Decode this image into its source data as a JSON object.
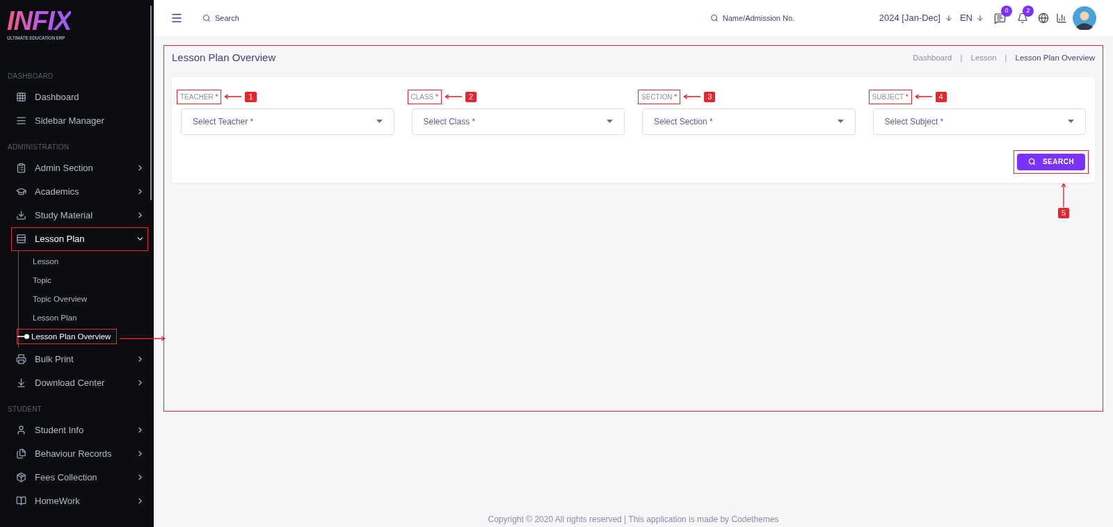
{
  "logo": {
    "name": "INFIX",
    "tagline": "ULTIMATE EDUCATION ERP"
  },
  "sidebar": {
    "sections": [
      {
        "title": "DASHBOARD",
        "items": [
          {
            "label": "Dashboard",
            "has_arrow": false,
            "expanded": false,
            "annotated": false
          },
          {
            "label": "Sidebar Manager",
            "has_arrow": false,
            "expanded": false,
            "annotated": false
          }
        ]
      },
      {
        "title": "ADMINISTRATION",
        "items": [
          {
            "label": "Admin Section",
            "has_arrow": true,
            "expanded": false,
            "annotated": false
          },
          {
            "label": "Academics",
            "has_arrow": true,
            "expanded": false,
            "annotated": false
          },
          {
            "label": "Study Material",
            "has_arrow": true,
            "expanded": false,
            "annotated": false
          },
          {
            "label": "Lesson Plan",
            "has_arrow": true,
            "expanded": true,
            "annotated": true,
            "children": [
              {
                "label": "Lesson",
                "selected": false,
                "annotated": false
              },
              {
                "label": "Topic",
                "selected": false,
                "annotated": false
              },
              {
                "label": "Topic Overview",
                "selected": false,
                "annotated": false
              },
              {
                "label": "Lesson Plan",
                "selected": false,
                "annotated": false
              },
              {
                "label": "Lesson Plan Overview",
                "selected": true,
                "annotated": true
              }
            ]
          },
          {
            "label": "Bulk Print",
            "has_arrow": true,
            "expanded": false,
            "annotated": false
          },
          {
            "label": "Download Center",
            "has_arrow": true,
            "expanded": false,
            "annotated": false
          }
        ]
      },
      {
        "title": "STUDENT",
        "items": [
          {
            "label": "Student Info",
            "has_arrow": true,
            "expanded": false,
            "annotated": false
          },
          {
            "label": "Behaviour Records",
            "has_arrow": true,
            "expanded": false,
            "annotated": false
          },
          {
            "label": "Fees Collection",
            "has_arrow": true,
            "expanded": false,
            "annotated": false
          },
          {
            "label": "HomeWork",
            "has_arrow": true,
            "expanded": false,
            "annotated": false
          }
        ]
      }
    ]
  },
  "topbar": {
    "search": {
      "placeholder": "Search"
    },
    "student_search": {
      "placeholder": "Name/Admission No."
    },
    "session": "2024 [Jan-Dec]",
    "language": "EN",
    "message_count": "0",
    "notification_count": "2"
  },
  "page": {
    "title": "Lesson Plan Overview",
    "breadcrumbs": [
      "Dashboard",
      "Lesson",
      "Lesson Plan Overview"
    ],
    "breadcrumb_separator": "|"
  },
  "fields": [
    {
      "label": "TEACHER",
      "required_mark": "*",
      "placeholder": "Select Teacher *",
      "callout": "1"
    },
    {
      "label": "CLASS",
      "required_mark": "*",
      "placeholder": "Select Class *",
      "callout": "2"
    },
    {
      "label": "SECTION",
      "required_mark": "*",
      "placeholder": "Select Section *",
      "callout": "3"
    },
    {
      "label": "SUBJECT",
      "required_mark": "*",
      "placeholder": "Select Subject *",
      "callout": "4"
    }
  ],
  "search_button": {
    "label": "SEARCH",
    "callout": "5"
  },
  "footer": "Copyright © 2020 All rights reserved | This application is made by Codethemes"
}
